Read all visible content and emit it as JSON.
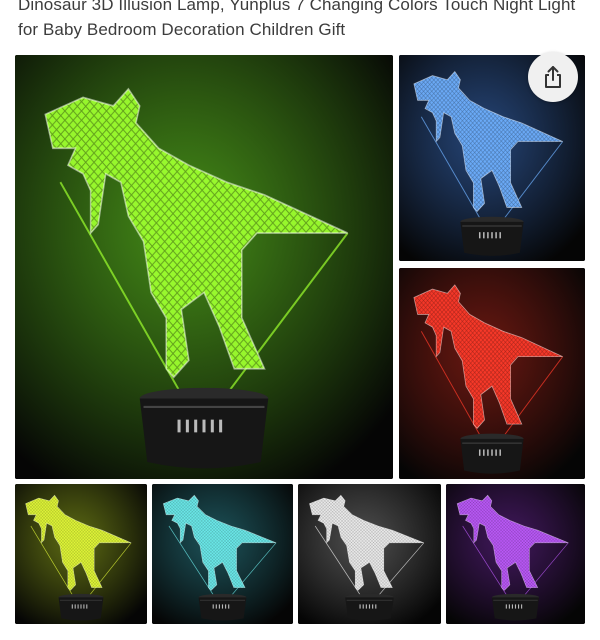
{
  "product": {
    "title": "Dinosaur 3D Illusion Lamp, Yunplus 7 Changing Colors Touch Night Light for Baby Bedroom Decoration Children Gift"
  },
  "share": {
    "icon": "share-icon"
  },
  "gallery": {
    "main": {
      "color": "#9dff2e",
      "glow": "#4fa31a"
    },
    "side": [
      {
        "color": "#6fb0ff",
        "glow": "#2a4f8a"
      },
      {
        "color": "#ff3a2a",
        "glow": "#7a1a12"
      }
    ],
    "bottom": [
      {
        "color": "#e8ff3a",
        "glow": "#6a7a14"
      },
      {
        "color": "#6ff0f0",
        "glow": "#1f5e66"
      },
      {
        "color": "#f2f2f2",
        "glow": "#5a5a5a"
      },
      {
        "color": "#c05cff",
        "glow": "#4a1a6a"
      }
    ]
  }
}
